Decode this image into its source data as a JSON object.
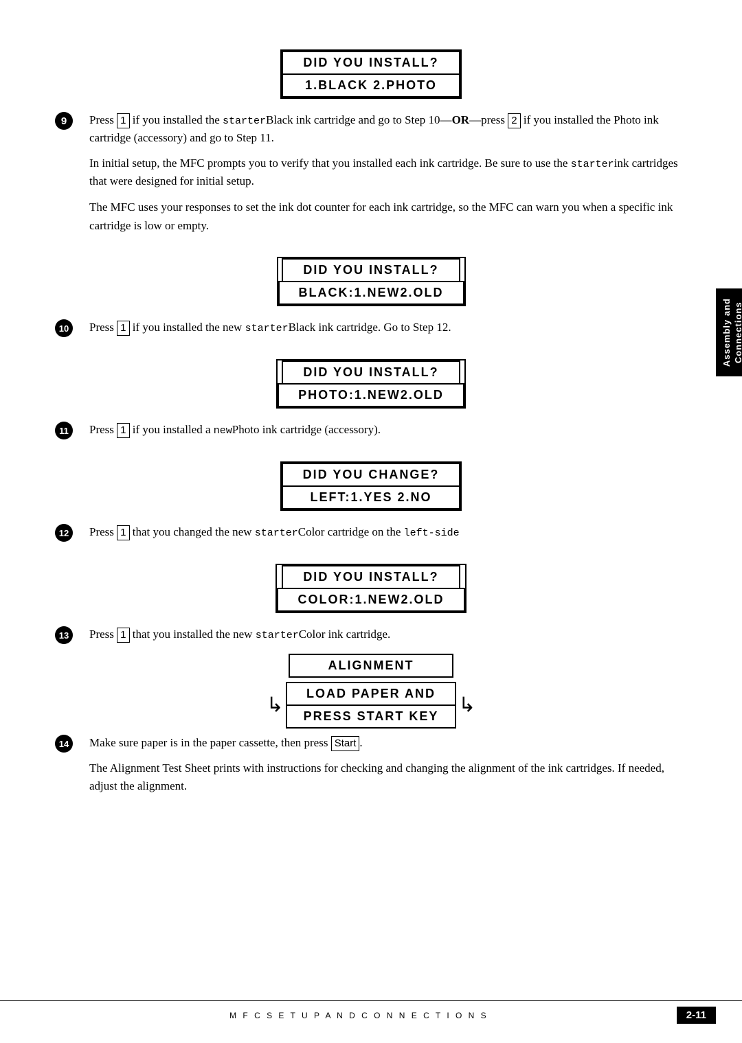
{
  "page": {
    "title": "MFC SETUP AND CONNECTIONS",
    "page_number": "2-11",
    "side_tab": "Assembly and\nConnections"
  },
  "displays": {
    "d1_line1": "DID YOU INSTALL?",
    "d1_line2": "1.BLACK 2.PHOTO",
    "d2_line1": "DID YOU INSTALL?",
    "d2_line2": "BLACK:1.NEW2.OLD",
    "d3_line1": "DID YOU INSTALL?",
    "d3_line2": "PHOTO:1.NEW2.OLD",
    "d4_line1": "DID YOU CHANGE?",
    "d4_line2": "LEFT:1.YES 2.NO",
    "d5_line1": "DID YOU INSTALL?",
    "d5_line2": "COLOR:1.NEW2.OLD",
    "d6_line1": "ALIGNMENT",
    "d6_line2": "LOAD PAPER AND",
    "d6_line3": "PRESS START KEY"
  },
  "steps": {
    "s9_text1": "Press ",
    "s9_key1": "1",
    "s9_text2": " if you installed the ",
    "s9_starter1": "starter",
    "s9_text3": "Black ink cartridge and go to Step 10—",
    "s9_bold1": "OR",
    "s9_text4": "—press ",
    "s9_key2": "2",
    "s9_text5": " if you installed the Photo ink cartridge (accessory) and go to Step 11.",
    "s9_para1": "In initial setup, the MFC prompts you to verify that you installed each ink cartridge. Be sure to use the ",
    "s9_starter2": "starter",
    "s9_para2": "ink cartridges that were designed for initial setup.",
    "s9_para3": "The MFC uses your responses to set the ink dot counter for each ink cartridge, so the MFC can warn you when a specific ink cartridge is low or empty.",
    "s10_text1": "Press ",
    "s10_key1": "1",
    "s10_text2": " if you installed the new ",
    "s10_starter": "starter",
    "s10_text3": "Black ink cartridge. Go to Step 12.",
    "s11_text1": "Press ",
    "s11_key1": "1",
    "s11_text2": " if you installed a ",
    "s11_new": "new",
    "s11_text3": "Photo ink cartridge (accessory).",
    "s12_text1": "Press ",
    "s12_key1": "1",
    "s12_text2": " that you changed the new ",
    "s12_starter": "starter",
    "s12_text3": "Color cartridge on the ",
    "s12_leftside": "left-side",
    "s13_text1": "Press ",
    "s13_key1": "1",
    "s13_text2": " that you installed the new ",
    "s13_starter": "starter",
    "s13_text3": "Color ink cartridge.",
    "s14_text1": "Make sure paper is in the paper cassette, then press ",
    "s14_key1": "Start",
    "s14_text2": ".",
    "s14_para1": "The Alignment Test Sheet prints with instructions for checking and changing the alignment of the ink cartridges. If needed, adjust the alignment."
  },
  "footer": {
    "text": "M F C   S E T U P   A N D   C O N N E C T I O N S",
    "page_num": "2-11"
  }
}
